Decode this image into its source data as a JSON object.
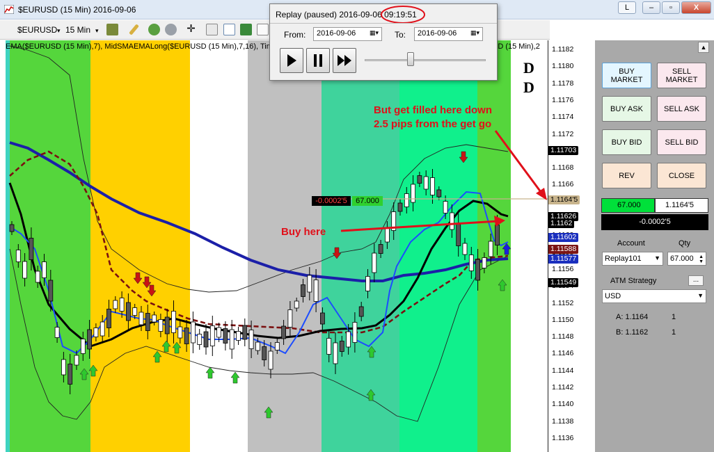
{
  "window": {
    "title": "$EURUSD (15 Min)  2016-09-06",
    "buttons": {
      "l": "L",
      "minimize": "–",
      "restore": "▫",
      "close": "X"
    }
  },
  "toolbar": {
    "instrument": "$EURUSD",
    "interval": "15 Min"
  },
  "indicators": {
    "label": "EMA($EURUSD (15 Min),7), MidSMAEMALong($EURUSD (15 Min),7,16), Tim",
    "label_right": "SD (15 Min),2"
  },
  "replay": {
    "title": "Replay (paused) 2016-09-06 09:19:51",
    "from_label": "From:",
    "from_value": "2016-09-06",
    "to_label": "To:",
    "to_value": "2016-09-06",
    "slider_position": 0.38
  },
  "axis": {
    "ticks": [
      "1.1182",
      "1.1180",
      "1.1178",
      "1.1176",
      "1.1174",
      "1.1172",
      "1.1170",
      "1.1168",
      "1.1166",
      "1.1164",
      "1.1162",
      "1.1160",
      "1.1158",
      "1.1156",
      "1.1154",
      "1.1152",
      "1.1150",
      "1.1148",
      "1.1146",
      "1.1144",
      "1.1142",
      "1.1140",
      "1.1138",
      "1.1136"
    ],
    "tags": [
      {
        "text": "1.11703",
        "color": "#000000"
      },
      {
        "text": "1.1164'5",
        "color": "#c8b48c",
        "fg": "#000000"
      },
      {
        "text": "1.11626",
        "color": "#000000"
      },
      {
        "text": "1.1162",
        "color": "#000000"
      },
      {
        "text": "1.11602",
        "color": "#1a2fbe"
      },
      {
        "text": "1.11588",
        "color": "#7b1414"
      },
      {
        "text": "1.11577",
        "color": "#1a2fbe"
      },
      {
        "text": "1.11549",
        "color": "#000000"
      }
    ]
  },
  "chart_overlay": {
    "pnl": "-0.0002'5",
    "qty": "67.000",
    "dd": "D\nD"
  },
  "annotations": {
    "buy_here": "Buy here",
    "filled_note": "But get filled here down 2.5 pips from the get go"
  },
  "panel": {
    "buy_market": "BUY MARKET",
    "sell_market": "SELL MARKET",
    "buy_ask": "BUY ASK",
    "sell_ask": "SELL ASK",
    "buy_bid": "BUY BID",
    "sell_bid": "SELL BID",
    "rev": "REV",
    "close": "CLOSE",
    "position_qty": "67.000",
    "position_price": "1.1164'5",
    "position_pnl": "-0.0002'5",
    "account_label": "Account",
    "qty_label": "Qty",
    "account_value": "Replay101",
    "qty_value": "67.000",
    "atm_label": "ATM Strategy",
    "atm_btn": "...",
    "currency": "USD",
    "ask_label": "A: 1.1164",
    "ask_size": "1",
    "bid_label": "B: 1.1162",
    "bid_size": "1"
  },
  "colors": {
    "green_band": "#55d63c",
    "yellow_band": "#ffd000",
    "white_band": "#ffffff",
    "grey_band": "#c0c0c0",
    "teal_band": "#3fd39c",
    "mint_band": "#10f08c",
    "sma_line": "#1b1fa8",
    "ema_line": "#1c4dff",
    "mid_line": "#000000",
    "dash_line": "#7a1010"
  }
}
